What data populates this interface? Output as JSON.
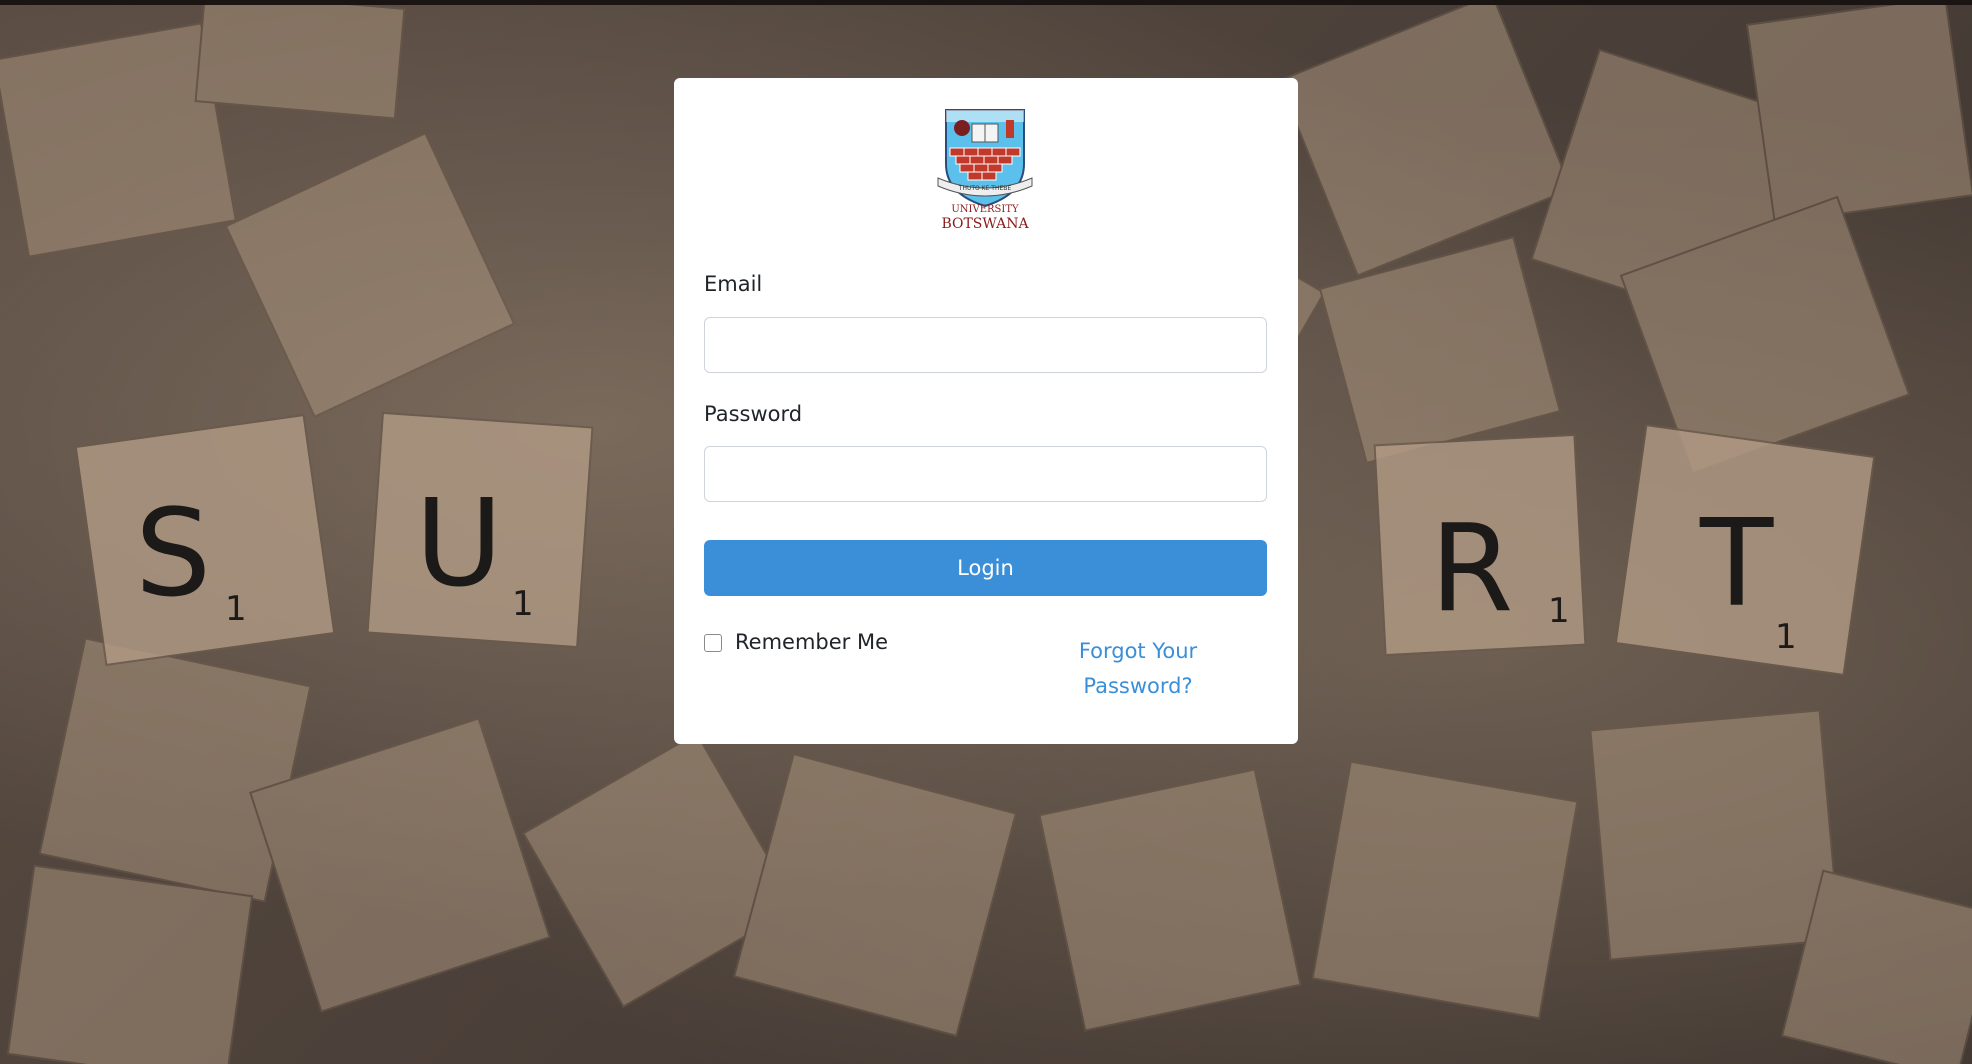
{
  "logo": {
    "motto": "THUTO KE THEBE",
    "name_line1": "UNIVERSITY",
    "name_line2": "BOTSWANA"
  },
  "form": {
    "email_label": "Email",
    "email_value": "",
    "password_label": "Password",
    "password_value": "",
    "login_label": "Login",
    "remember_label": "Remember Me",
    "remember_checked": false,
    "forgot_line1": "Forgot Your",
    "forgot_line2": "Password?"
  },
  "background": {
    "tile_letters": [
      "S",
      "U",
      "R",
      "T"
    ],
    "tile_scores": [
      "1",
      "1",
      "1",
      "1"
    ]
  },
  "colors": {
    "accent": "#3a8fd8",
    "card": "#ffffff",
    "crest_red": "#8b1a1a",
    "crest_blue": "#5bc0eb"
  }
}
